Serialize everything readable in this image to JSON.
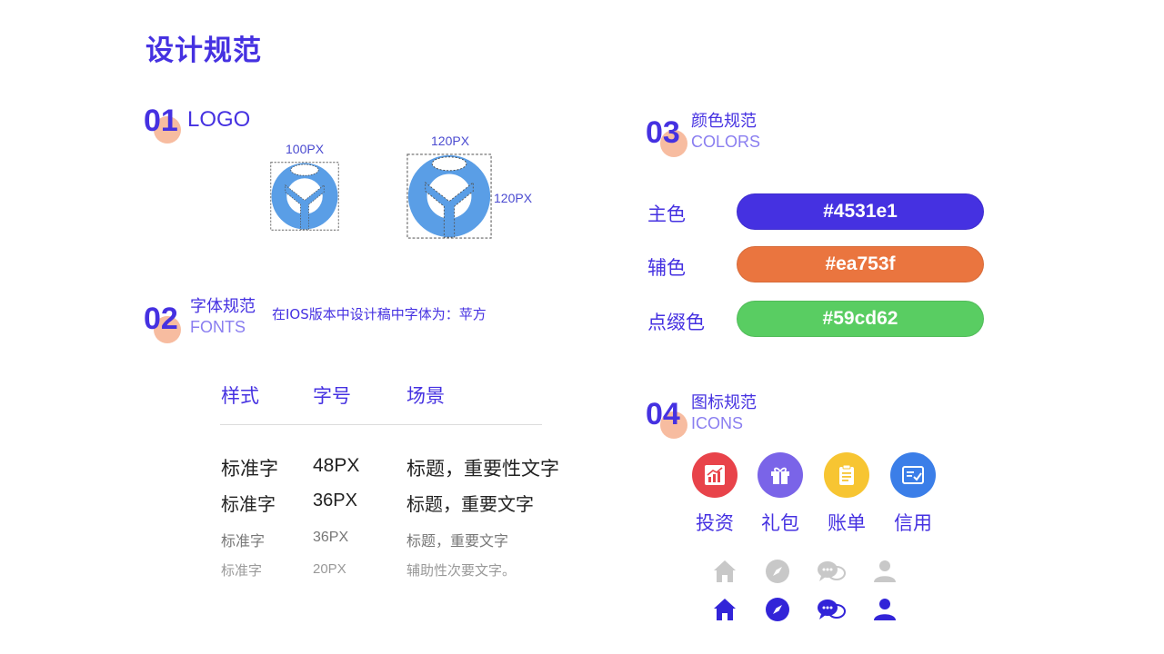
{
  "page_title": "设计规范",
  "sections": {
    "logo": {
      "num": "01",
      "title": "LOGO",
      "small_size": "100PX",
      "large_width": "120PX",
      "large_height": "120PX"
    },
    "fonts": {
      "num": "02",
      "title_cn": "字体规范",
      "title_en": "FONTS",
      "note": "在IOS版本中设计稿中字体为：苹方"
    },
    "colors": {
      "num": "03",
      "title_cn": "颜色规范",
      "title_en": "COLORS"
    },
    "icons": {
      "num": "04",
      "title_cn": "图标规范",
      "title_en": "ICONS"
    }
  },
  "font_table": {
    "headers": [
      "样式",
      "字号",
      "场景"
    ],
    "rows": [
      [
        "标准字",
        "48PX",
        "标题，重要性文字"
      ],
      [
        "标准字",
        "36PX",
        "标题，重要文字"
      ],
      [
        "标准字",
        "36PX",
        "标题，重要文字"
      ],
      [
        "标准字",
        "20PX",
        "辅助性次要文字。"
      ]
    ]
  },
  "colors": [
    {
      "label": "主色",
      "hex": "#4531e1"
    },
    {
      "label": "辅色",
      "hex": "#ea753f"
    },
    {
      "label": "点缀色",
      "hex": "#59cd62"
    }
  ],
  "app_icons": [
    {
      "label": "投资",
      "icon": "chart-icon",
      "color": "#e8434a"
    },
    {
      "label": "礼包",
      "icon": "gift-icon",
      "color": "#7a64e8"
    },
    {
      "label": "账单",
      "icon": "clipboard-icon",
      "color": "#f7c532"
    },
    {
      "label": "信用",
      "icon": "checklist-icon",
      "color": "#3b7ee8"
    }
  ],
  "nav_icons": [
    {
      "icon": "home-icon"
    },
    {
      "icon": "compass-icon"
    },
    {
      "icon": "chat-icon"
    },
    {
      "icon": "user-icon"
    }
  ],
  "nav_colors": {
    "inactive": "#c8c8c8",
    "active": "#3224d8"
  },
  "logo_color": "#5a9ee6"
}
